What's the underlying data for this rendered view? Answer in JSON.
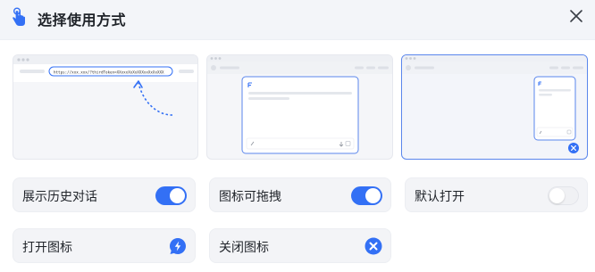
{
  "dialog": {
    "title": "选择使用方式",
    "icon": "hand-pointer-icon",
    "close_icon": "close-icon"
  },
  "modes": [
    {
      "name": "url-bar-mode",
      "url_text": "https://xxx.xxx/?thirdToken=XXxxxXxXxXXXxxXxXxXXX",
      "selected": false
    },
    {
      "name": "center-window-mode",
      "selected": false
    },
    {
      "name": "side-window-mode",
      "selected": true
    }
  ],
  "options": {
    "history": {
      "label": "展示历史对话",
      "enabled": true
    },
    "draggable": {
      "label": "图标可拖拽",
      "enabled": true
    },
    "default_open": {
      "label": "默认打开",
      "enabled": false
    },
    "open_icon": {
      "label": "打开图标",
      "icon": "lightning-chat-icon"
    },
    "close_icon": {
      "label": "关闭图标",
      "icon": "close-circle-icon"
    }
  },
  "colors": {
    "accent": "#3370f5",
    "selected_border": "#5a86ec",
    "toggle_off": "#f0f1f4"
  }
}
